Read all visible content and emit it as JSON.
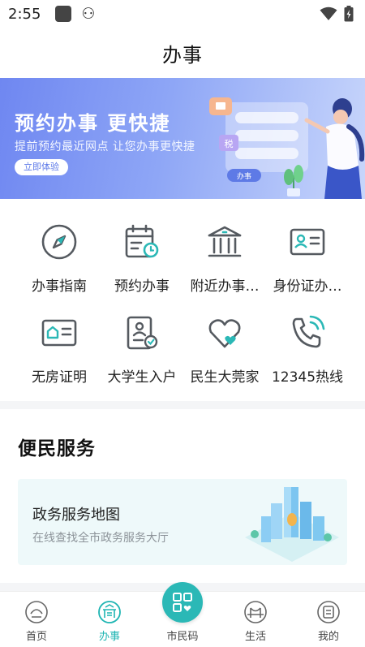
{
  "status_bar": {
    "time": "2:55"
  },
  "header": {
    "title": "办事"
  },
  "banner": {
    "headline": "预约办事 更快捷",
    "subtitle": "提前预约最近网点 让您办事更快捷",
    "cta_label": "立即体验",
    "badge_tax": "税",
    "badge_office": "办事"
  },
  "services_grid": [
    {
      "label": "办事指南",
      "icon": "compass-icon"
    },
    {
      "label": "预约办事",
      "icon": "calendar-clock-icon"
    },
    {
      "label": "附近办事…",
      "icon": "bank-building-icon"
    },
    {
      "label": "身份证办…",
      "icon": "id-card-icon"
    },
    {
      "label": "无房证明",
      "icon": "house-card-icon"
    },
    {
      "label": "大学生入户",
      "icon": "document-person-icon"
    },
    {
      "label": "民生大莞家",
      "icon": "hearts-icon"
    },
    {
      "label": "12345热线",
      "icon": "phone-call-icon"
    }
  ],
  "convenience": {
    "section_title": "便民服务",
    "card_title": "政务服务地图",
    "card_subtitle": "在线查找全市政务服务大厅"
  },
  "bottom_nav": [
    {
      "label": "首页",
      "icon": "home-emblem-icon",
      "active": false
    },
    {
      "label": "办事",
      "icon": "gate-emblem-icon",
      "active": true
    },
    {
      "label": "市民码",
      "icon": "qr-code-icon",
      "active": false
    },
    {
      "label": "生活",
      "icon": "bridge-emblem-icon",
      "active": false
    },
    {
      "label": "我的",
      "icon": "profile-emblem-icon",
      "active": false
    }
  ],
  "colors": {
    "accent": "#1fb5b3",
    "icon_stroke": "#555a60",
    "banner_start": "#6f87f1",
    "banner_end": "#c8d6fb",
    "card_bg": "#eef9fa"
  }
}
